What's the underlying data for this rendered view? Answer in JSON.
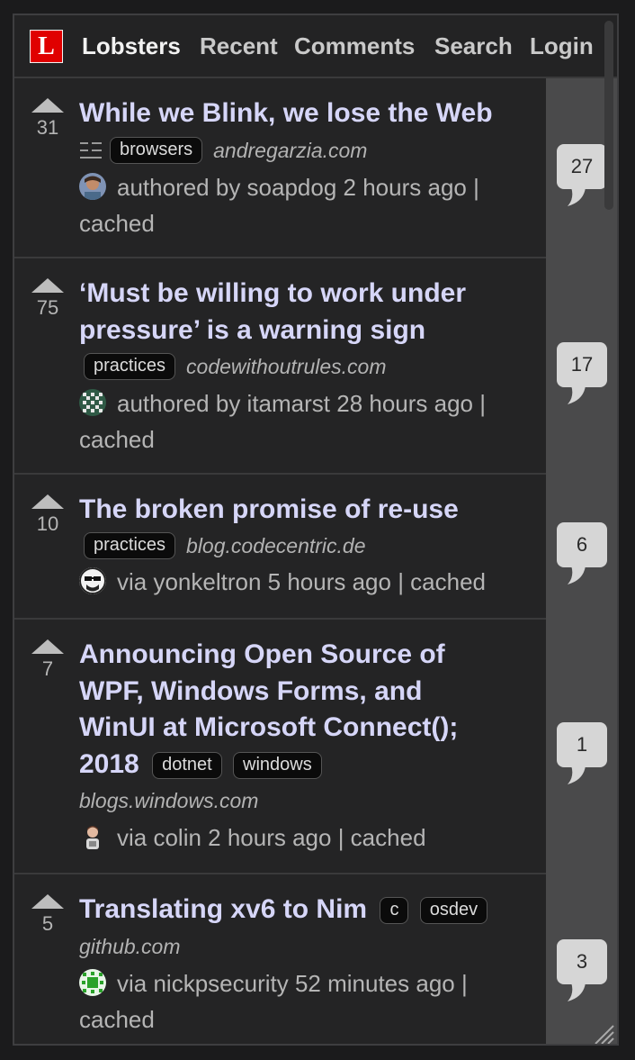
{
  "nav": {
    "logo_letter": "L",
    "brand": "Lobsters",
    "recent": "Recent",
    "comments": "Comments",
    "search": "Search",
    "login": "Login"
  },
  "stories": [
    {
      "score": "31",
      "title": "While we Blink, we lose the Web",
      "tags": [
        "browsers"
      ],
      "domain": "andregarzia.com",
      "byline_1": "authored by soapdog 2 hours ago |",
      "byline_2": "cached",
      "comments": "27"
    },
    {
      "score": "75",
      "title_1": "‘Must be willing to work under",
      "title_2": "pressure’ is a warning sign",
      "tags": [
        "practices"
      ],
      "domain": "codewithoutrules.com",
      "byline_1": "authored by itamarst 28 hours ago |",
      "byline_2": "cached",
      "comments": "17"
    },
    {
      "score": "10",
      "title": "The broken promise of re-use",
      "tags": [
        "practices"
      ],
      "domain": "blog.codecentric.de",
      "byline_1": "via yonkeltron 5 hours ago | cached",
      "comments": "6"
    },
    {
      "score": "7",
      "title_1": "Announcing Open Source of",
      "title_2": "WPF, Windows Forms, and",
      "title_3": "WinUI at Microsoft Connect();",
      "title_4": "2018",
      "tags": [
        "dotnet",
        "windows"
      ],
      "domain": "blogs.windows.com",
      "byline_1": "via colin 2 hours ago | cached",
      "comments": "1"
    },
    {
      "score": "5",
      "title": "Translating xv6 to Nim",
      "tags": [
        "c",
        "osdev"
      ],
      "domain": "github.com",
      "byline_1": "via nickpsecurity 52 minutes ago |",
      "byline_2": "cached",
      "comments": "3"
    }
  ]
}
